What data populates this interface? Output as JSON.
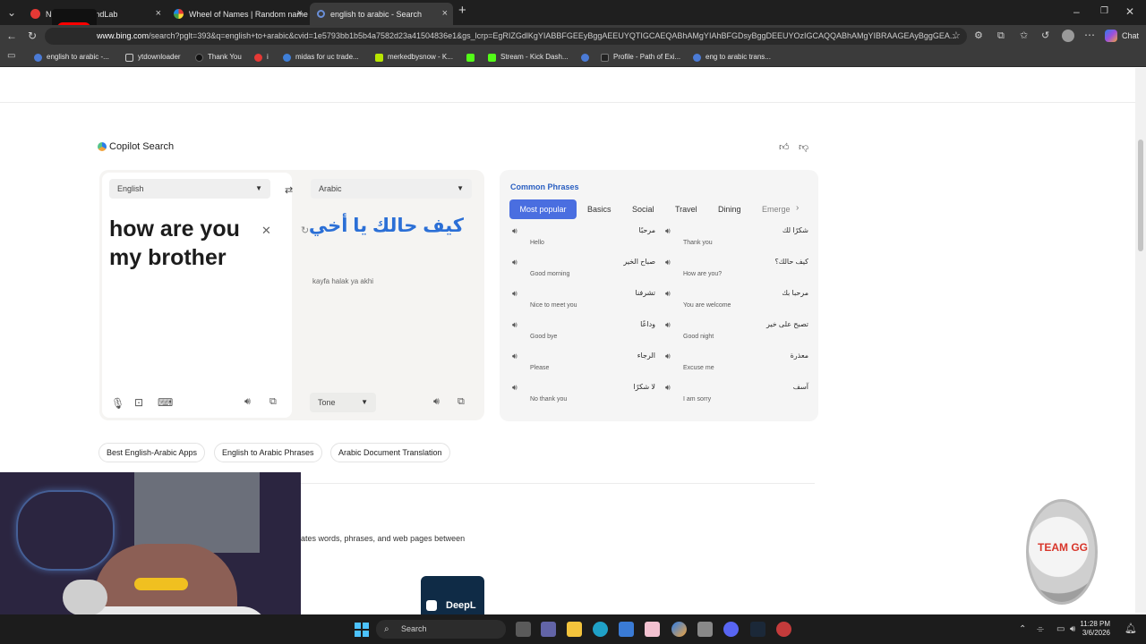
{
  "tabs": [
    {
      "label": "NC... H8! | BandLab",
      "favicon_color": "#e53935"
    },
    {
      "label": "Wheel of Names | Random name p",
      "favicon_color": "#4caf50"
    },
    {
      "label": "english to arabic - Search",
      "favicon_color": "#4b7bd6"
    }
  ],
  "address": {
    "url_prefix": "www.bing.com",
    "url_rest": "/search?pglt=393&q=english+to+arabic&cvid=1e5793bb1b5b4a7582d23a41504836e1&gs_lcrp=EgRIZGdlKgYIABBFGEEyBggAEEUYQTIGCAEQABhAMgYIAhBFGDsyBggDEEUYOzIGCAQQABhAMgYIBRAAGEAyBggGEA..."
  },
  "favorites": [
    {
      "label": "english to arabic -...",
      "color": "#4b7bd6"
    },
    {
      "label": "ytdownloader",
      "color": "#9e9e9e"
    },
    {
      "label": "Thank You",
      "color": "#111111"
    },
    {
      "label": "i",
      "color": "#e53935"
    },
    {
      "label": "midas for uc trade...",
      "color": "#3f7fd8"
    },
    {
      "label": "merkedbysnow - K...",
      "color": "#b8e600"
    },
    {
      "label": "",
      "color": "#53fc18"
    },
    {
      "label": "Stream - Kick Dash...",
      "color": "#53fc18"
    },
    {
      "label": "",
      "color": "#4b7bd6"
    },
    {
      "label": "Profile - Path of Exi...",
      "color": "#222222"
    },
    {
      "label": "eng to arabic trans...",
      "color": "#4b7bd6"
    }
  ],
  "chrome_right": {
    "chat_label": "Chat"
  },
  "copilot": {
    "title": "Copilot Search"
  },
  "translator": {
    "source_lang": "English",
    "target_lang": "Arabic",
    "source_text_line1": "how are you",
    "source_text_line2": "my brother",
    "translated_text": "كيف حالك يا أخي",
    "transliteration": "kayfa halak ya akhi",
    "tone_label": "Tone"
  },
  "phrases": {
    "title": "Common Phrases",
    "tabs": [
      "Most popular",
      "Basics",
      "Social",
      "Travel",
      "Dining",
      "Emerge"
    ],
    "items": [
      {
        "ar": "مرحبًا",
        "en": "Hello"
      },
      {
        "ar": "شكرًا لك",
        "en": "Thank you"
      },
      {
        "ar": "صباح الخير",
        "en": "Good morning"
      },
      {
        "ar": "كيف حالك؟",
        "en": "How are you?"
      },
      {
        "ar": "تشرفنا",
        "en": "Nice to meet you"
      },
      {
        "ar": "مرحبا بك",
        "en": "You are welcome"
      },
      {
        "ar": "وداعًا",
        "en": "Good bye"
      },
      {
        "ar": "تصبح على خير",
        "en": "Good night"
      },
      {
        "ar": "الرجاء",
        "en": "Please"
      },
      {
        "ar": "معذرة",
        "en": "Excuse me"
      },
      {
        "ar": "لا شكرًا",
        "en": "No thank you"
      },
      {
        "ar": "آسف",
        "en": "I am sorry"
      }
    ]
  },
  "suggestions": [
    "Best English-Arabic Apps",
    "English to Arabic Phrases",
    "Arabic Document Translation"
  ],
  "body_snippet": "ates words, phrases, and web pages between",
  "deepl_label": "DeepL",
  "badge_text": "TEAM GG",
  "taskbar": {
    "search_label": "Search",
    "time": "11:28 PM",
    "date": "3/6/2026"
  }
}
